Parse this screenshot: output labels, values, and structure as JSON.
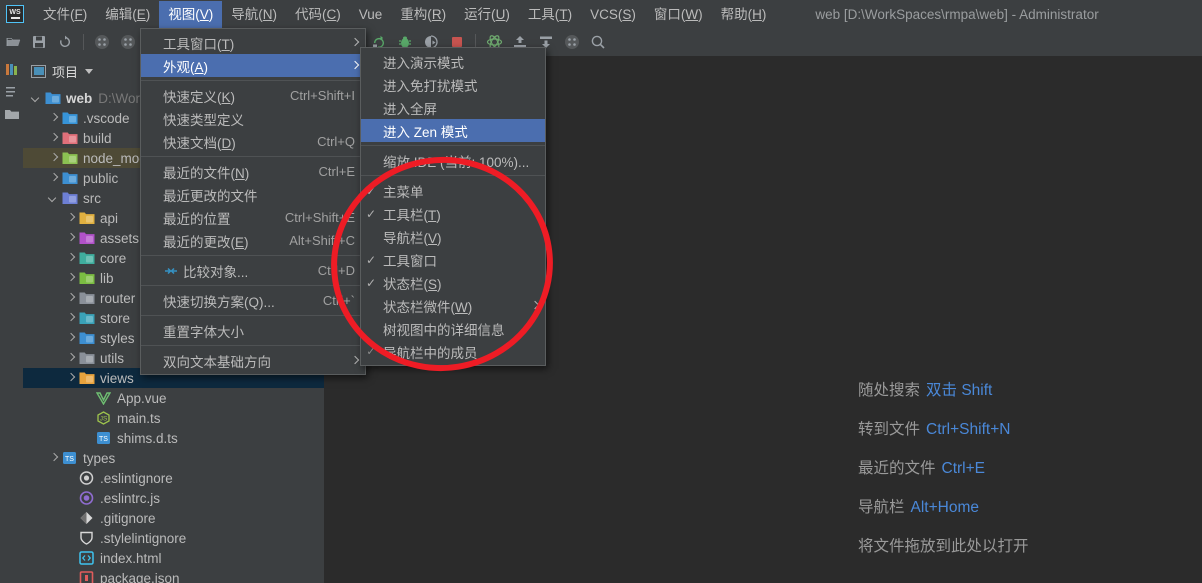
{
  "app": {
    "logo_text": "WS",
    "window_title": "web [D:\\WorkSpaces\\rmpa\\web] - Administrator"
  },
  "menubar": {
    "items": [
      {
        "label": "文件(F)",
        "mnemonic": "F",
        "active": false
      },
      {
        "label": "编辑(E)",
        "mnemonic": "E",
        "active": false
      },
      {
        "label": "视图(V)",
        "mnemonic": "V",
        "active": true
      },
      {
        "label": "导航(N)",
        "mnemonic": "N",
        "active": false
      },
      {
        "label": "代码(C)",
        "mnemonic": "C",
        "active": false
      },
      {
        "label": "Vue",
        "mnemonic": "",
        "active": false
      },
      {
        "label": "重构(R)",
        "mnemonic": "R",
        "active": false
      },
      {
        "label": "运行(U)",
        "mnemonic": "U",
        "active": false
      },
      {
        "label": "工具(T)",
        "mnemonic": "T",
        "active": false
      },
      {
        "label": "VCS(S)",
        "mnemonic": "S",
        "active": false
      },
      {
        "label": "窗口(W)",
        "mnemonic": "W",
        "active": false
      },
      {
        "label": "帮助(H)",
        "mnemonic": "H",
        "active": false
      }
    ]
  },
  "toolbar": {
    "left_icons": [
      {
        "name": "open-folder-icon"
      },
      {
        "name": "save-all-icon"
      },
      {
        "name": "sync-refresh-icon"
      },
      {
        "name": "separator"
      },
      {
        "name": "grid-left-icon"
      },
      {
        "name": "grid-right-icon"
      }
    ],
    "right_icons": [
      {
        "name": "run-icon",
        "color": "#5a9e5a"
      },
      {
        "name": "debug-icon",
        "color": "#69a469"
      },
      {
        "name": "run-with-coverage-icon",
        "color": "#9aa0a6"
      },
      {
        "name": "stop-icon",
        "color": "#c75450"
      },
      {
        "name": "separator"
      },
      {
        "name": "vue-devtools-icon",
        "color": "#6ea96e"
      },
      {
        "name": "update-project-icon",
        "color": "#9aa0a6"
      },
      {
        "name": "commit-icon",
        "color": "#9aa0a6"
      },
      {
        "name": "settings-grid-icon",
        "color": "#9aa0a6"
      },
      {
        "name": "search-everywhere-icon",
        "color": "#9aa0a6"
      }
    ]
  },
  "project_panel": {
    "title": "项目",
    "tree": [
      {
        "indent": 0,
        "arrow": "down",
        "icon": "folder-web-icon",
        "icon_color": "#3d8fd1",
        "label": "web",
        "bold": true,
        "sub": "D:\\Wor",
        "state": "normal"
      },
      {
        "indent": 1,
        "arrow": "right",
        "icon": "folder-vscode-icon",
        "icon_color": "#3794d8",
        "label": ".vscode",
        "bold": false,
        "sub": "",
        "state": "normal"
      },
      {
        "indent": 1,
        "arrow": "right",
        "icon": "folder-build-icon",
        "icon_color": "#e1707a",
        "label": "build",
        "bold": false,
        "sub": "",
        "state": "normal"
      },
      {
        "indent": 1,
        "arrow": "right",
        "icon": "folder-node-icon",
        "icon_color": "#8cc152",
        "label": "node_mod",
        "bold": false,
        "sub": "",
        "state": "olive"
      },
      {
        "indent": 1,
        "arrow": "right",
        "icon": "folder-public-icon",
        "icon_color": "#3d8fd1",
        "label": "public",
        "bold": false,
        "sub": "",
        "state": "normal"
      },
      {
        "indent": 1,
        "arrow": "down",
        "icon": "folder-src-icon",
        "icon_color": "#6d7fd4",
        "label": "src",
        "bold": false,
        "sub": "",
        "state": "normal"
      },
      {
        "indent": 2,
        "arrow": "right",
        "icon": "folder-api-icon",
        "icon_color": "#e0b040",
        "label": "api",
        "bold": false,
        "sub": "",
        "state": "normal"
      },
      {
        "indent": 2,
        "arrow": "right",
        "icon": "folder-assets-icon",
        "icon_color": "#b152c9",
        "label": "assets",
        "bold": false,
        "sub": "",
        "state": "normal"
      },
      {
        "indent": 2,
        "arrow": "right",
        "icon": "folder-core-icon",
        "icon_color": "#3fae9e",
        "label": "core",
        "bold": false,
        "sub": "",
        "state": "normal"
      },
      {
        "indent": 2,
        "arrow": "right",
        "icon": "folder-lib-icon",
        "icon_color": "#7bbd42",
        "label": "lib",
        "bold": false,
        "sub": "",
        "state": "normal"
      },
      {
        "indent": 2,
        "arrow": "right",
        "icon": "folder-router-icon",
        "icon_color": "#8a9099",
        "label": "router",
        "bold": false,
        "sub": "",
        "state": "normal"
      },
      {
        "indent": 2,
        "arrow": "right",
        "icon": "folder-store-icon",
        "icon_color": "#3aa2b8",
        "label": "store",
        "bold": false,
        "sub": "",
        "state": "normal"
      },
      {
        "indent": 2,
        "arrow": "right",
        "icon": "folder-styles-icon",
        "icon_color": "#3d8fd1",
        "label": "styles",
        "bold": false,
        "sub": "",
        "state": "normal"
      },
      {
        "indent": 2,
        "arrow": "right",
        "icon": "folder-utils-icon",
        "icon_color": "#8a9099",
        "label": "utils",
        "bold": false,
        "sub": "",
        "state": "normal"
      },
      {
        "indent": 2,
        "arrow": "right",
        "icon": "folder-views-icon",
        "icon_color": "#e8a33d",
        "label": "views",
        "bold": false,
        "sub": "",
        "state": "blue"
      },
      {
        "indent": 3,
        "arrow": "none",
        "icon": "vue-file-icon",
        "icon_color": "#6fbf72",
        "label": "App.vue",
        "bold": false,
        "sub": "",
        "state": "normal"
      },
      {
        "indent": 3,
        "arrow": "none",
        "icon": "js-file-icon",
        "icon_color": "#9ec44d",
        "label": "main.ts",
        "bold": false,
        "sub": "",
        "state": "normal"
      },
      {
        "indent": 3,
        "arrow": "none",
        "icon": "ts-declaration-icon",
        "icon_color": "#3d8fd1",
        "label": "shims.d.ts",
        "bold": false,
        "sub": "",
        "state": "normal"
      },
      {
        "indent": 1,
        "arrow": "right",
        "icon": "folder-types-icon",
        "icon_color": "#3d8fd1",
        "label": "types",
        "bold": false,
        "sub": "",
        "state": "normal"
      },
      {
        "indent": 2,
        "arrow": "none",
        "icon": "eslint-ignore-icon",
        "icon_color": "#cfcfcf",
        "label": ".eslintignore",
        "bold": false,
        "sub": "",
        "state": "normal"
      },
      {
        "indent": 2,
        "arrow": "none",
        "icon": "eslintrc-icon",
        "icon_color": "#8f6cd0",
        "label": ".eslintrc.js",
        "bold": false,
        "sub": "",
        "state": "normal"
      },
      {
        "indent": 2,
        "arrow": "none",
        "icon": "gitignore-icon",
        "icon_color": "#d8d8d8",
        "label": ".gitignore",
        "bold": false,
        "sub": "",
        "state": "normal"
      },
      {
        "indent": 2,
        "arrow": "none",
        "icon": "stylelint-icon",
        "icon_color": "#d8d8d8",
        "label": ".stylelintignore",
        "bold": false,
        "sub": "",
        "state": "normal"
      },
      {
        "indent": 2,
        "arrow": "none",
        "icon": "html-file-icon",
        "icon_color": "#3ec4ef",
        "label": "index.html",
        "bold": false,
        "sub": "",
        "state": "normal"
      },
      {
        "indent": 2,
        "arrow": "none",
        "icon": "json-file-icon",
        "icon_color": "#e05c5c",
        "label": "package.json",
        "bold": false,
        "sub": "",
        "state": "normal"
      }
    ]
  },
  "view_menu": {
    "items": [
      {
        "type": "item",
        "label": "工具窗口(T)",
        "accel": "",
        "submenu": true,
        "check": "",
        "icon": ""
      },
      {
        "type": "item",
        "label": "外观(A)",
        "accel": "",
        "submenu": true,
        "check": "",
        "icon": "",
        "highlight": true
      },
      {
        "type": "separator"
      },
      {
        "type": "item",
        "label": "快速定义(K)",
        "accel": "Ctrl+Shift+I",
        "submenu": false,
        "check": "",
        "icon": ""
      },
      {
        "type": "item",
        "label": "快速类型定义",
        "accel": "",
        "submenu": false,
        "check": "",
        "icon": ""
      },
      {
        "type": "item",
        "label": "快速文档(D)",
        "accel": "Ctrl+Q",
        "submenu": false,
        "check": "",
        "icon": ""
      },
      {
        "type": "separator"
      },
      {
        "type": "item",
        "label": "最近的文件(N)",
        "accel": "Ctrl+E",
        "submenu": false,
        "check": "",
        "icon": ""
      },
      {
        "type": "item",
        "label": "最近更改的文件",
        "accel": "",
        "submenu": false,
        "check": "",
        "icon": ""
      },
      {
        "type": "item",
        "label": "最近的位置",
        "accel": "Ctrl+Shift+E",
        "submenu": false,
        "check": "",
        "icon": ""
      },
      {
        "type": "item",
        "label": "最近的更改(E)",
        "accel": "Alt+Shift+C",
        "submenu": false,
        "check": "",
        "icon": ""
      },
      {
        "type": "separator"
      },
      {
        "type": "item",
        "label": "比较对象...",
        "accel": "Ctrl+D",
        "submenu": false,
        "check": "",
        "icon": "compare-icon"
      },
      {
        "type": "separator"
      },
      {
        "type": "item",
        "label": "快速切换方案(Q)...",
        "accel": "Ctrl+`",
        "submenu": false,
        "check": "",
        "icon": ""
      },
      {
        "type": "separator"
      },
      {
        "type": "item",
        "label": "重置字体大小",
        "accel": "",
        "submenu": false,
        "check": "",
        "icon": ""
      },
      {
        "type": "separator"
      },
      {
        "type": "item",
        "label": "双向文本基础方向",
        "accel": "",
        "submenu": true,
        "check": "",
        "icon": ""
      }
    ]
  },
  "appearance_menu": {
    "items": [
      {
        "type": "item",
        "label": "进入演示模式",
        "check": "",
        "submenu": false,
        "highlight": false
      },
      {
        "type": "item",
        "label": "进入免打扰模式",
        "check": "",
        "submenu": false,
        "highlight": false
      },
      {
        "type": "item",
        "label": "进入全屏",
        "check": "",
        "submenu": false,
        "highlight": false
      },
      {
        "type": "item",
        "label": "进入 Zen 模式",
        "check": "",
        "submenu": false,
        "highlight": true
      },
      {
        "type": "separator"
      },
      {
        "type": "item",
        "label": "缩放 IDE (当前: 100%)...",
        "check": "",
        "submenu": false,
        "highlight": false
      },
      {
        "type": "separator"
      },
      {
        "type": "item",
        "label": "主菜单",
        "check": "✓",
        "submenu": false,
        "highlight": false
      },
      {
        "type": "item",
        "label": "工具栏(T)",
        "check": "✓",
        "submenu": false,
        "highlight": false
      },
      {
        "type": "item",
        "label": "导航栏(V)",
        "check": "",
        "submenu": false,
        "highlight": false
      },
      {
        "type": "item",
        "label": "工具窗口",
        "check": "✓",
        "submenu": false,
        "highlight": false
      },
      {
        "type": "item",
        "label": "状态栏(S)",
        "check": "✓",
        "submenu": false,
        "highlight": false
      },
      {
        "type": "item",
        "label": "状态栏微件(W)",
        "check": "",
        "submenu": true,
        "highlight": false
      },
      {
        "type": "item",
        "label": "树视图中的详细信息",
        "check": "",
        "submenu": false,
        "highlight": false
      },
      {
        "type": "item",
        "label": "导航栏中的成员",
        "check": "✓",
        "submenu": false,
        "highlight": false
      }
    ]
  },
  "editor_hints": {
    "rows": [
      {
        "text": "随处搜索",
        "key": "双击 Shift"
      },
      {
        "text": "转到文件",
        "key": "Ctrl+Shift+N"
      },
      {
        "text": "最近的文件",
        "key": "Ctrl+E"
      },
      {
        "text": "导航栏",
        "key": "Alt+Home"
      },
      {
        "text": "将文件拖放到此处以打开",
        "key": ""
      }
    ]
  },
  "annotation": {
    "shape": "ellipse",
    "color": "#ee1c25",
    "stroke_width": 6
  },
  "colors": {
    "menu_bg": "#3c3f41",
    "editor_bg": "#2b2b2b",
    "highlight": "#4b6eaf",
    "selection_blue": "#0d293e",
    "selection_olive": "#4e4a36",
    "hint_key": "#4a88d8",
    "annotation_red": "#ee1c25"
  }
}
